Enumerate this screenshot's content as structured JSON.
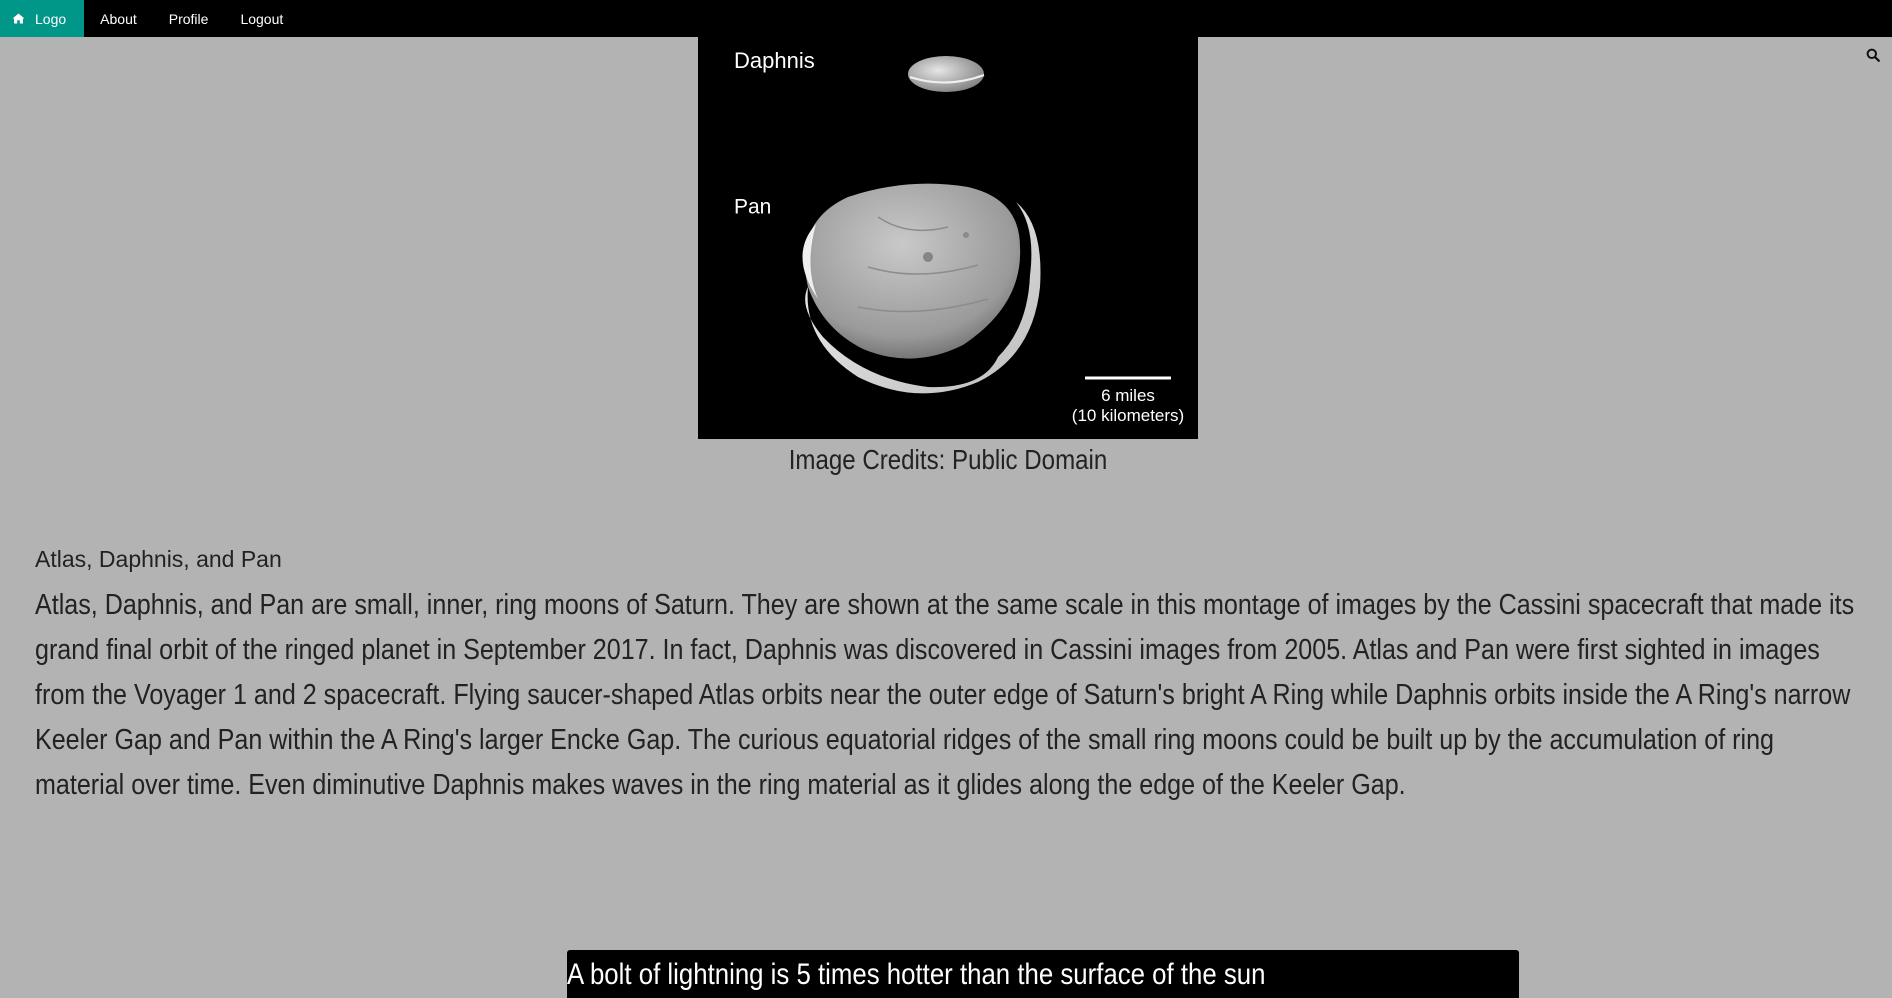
{
  "nav": {
    "logo_label": "Logo",
    "items": [
      {
        "label": "About"
      },
      {
        "label": "Profile"
      },
      {
        "label": "Logout"
      }
    ],
    "logo_icon": "home-icon",
    "search_icon": "search-icon",
    "accent_color": "#009688"
  },
  "figure": {
    "label_daphnis": "Daphnis",
    "label_pan": "Pan",
    "scale_miles": "6 miles",
    "scale_km": "(10 kilometers)"
  },
  "caption": "Image Credits: Public Domain",
  "article": {
    "title": "Atlas, Daphnis, and Pan",
    "body": "Atlas, Daphnis, and Pan are small, inner, ring moons of Saturn. They are shown at the same scale in this montage of images by the Cassini spacecraft that made its grand final orbit of the ringed planet in September 2017. In fact, Daphnis was discovered in Cassini images from 2005. Atlas and Pan were first sighted in images from the Voyager 1 and 2 spacecraft. Flying saucer-shaped Atlas orbits near the outer edge of Saturn's bright A Ring while Daphnis orbits inside the A Ring's narrow Keeler Gap and Pan within the A Ring's larger Encke Gap. The curious equatorial ridges of the small ring moons could be built up by the accumulation of ring material over time. Even diminutive Daphnis makes waves in the ring material as it glides along the edge of the Keeler Gap."
  },
  "fact": "A bolt of lightning is 5 times hotter than the surface of the sun"
}
